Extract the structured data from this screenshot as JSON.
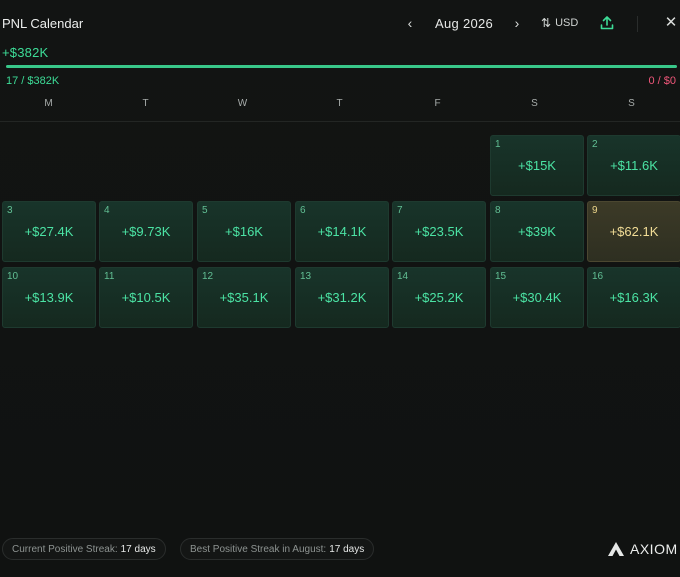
{
  "header": {
    "title": "PNL Calendar",
    "month": "Aug 2026",
    "currency": "USD",
    "icons": {
      "prev": "chevron-left-icon",
      "next": "chevron-right-icon",
      "currency": "sort-arrows-icon",
      "share": "upload-icon",
      "close": "close-icon"
    }
  },
  "summary": {
    "total": "+$382K",
    "positive": "17 / $382K",
    "negative": "0 / $0",
    "positive_fraction": 1.0,
    "colors": {
      "positive": "#3ddc97",
      "negative": "#f0577a"
    }
  },
  "weekdays": [
    "M",
    "T",
    "W",
    "T",
    "F",
    "S",
    "S"
  ],
  "days": [
    {
      "day": "1",
      "value": "+$15K"
    },
    {
      "day": "2",
      "value": "+$11.6K"
    },
    {
      "day": "3",
      "value": "+$27.4K"
    },
    {
      "day": "4",
      "value": "+$9.73K"
    },
    {
      "day": "5",
      "value": "+$16K"
    },
    {
      "day": "6",
      "value": "+$14.1K"
    },
    {
      "day": "7",
      "value": "+$23.5K"
    },
    {
      "day": "8",
      "value": "+$39K"
    },
    {
      "day": "9",
      "value": "+$62.1K",
      "highlight": true
    },
    {
      "day": "10",
      "value": "+$13.9K"
    },
    {
      "day": "11",
      "value": "+$10.5K"
    },
    {
      "day": "12",
      "value": "+$35.1K"
    },
    {
      "day": "13",
      "value": "+$31.2K"
    },
    {
      "day": "14",
      "value": "+$25.2K"
    },
    {
      "day": "15",
      "value": "+$30.4K"
    },
    {
      "day": "16",
      "value": "+$16.3K"
    }
  ],
  "footer": {
    "current_streak_label": "Current Positive Streak:",
    "current_streak_value": "17 days",
    "best_streak_label": "Best Positive Streak in August:",
    "best_streak_value": "17 days",
    "brand": "AXIOM",
    "brand_icon": "axiom-logo-icon"
  }
}
